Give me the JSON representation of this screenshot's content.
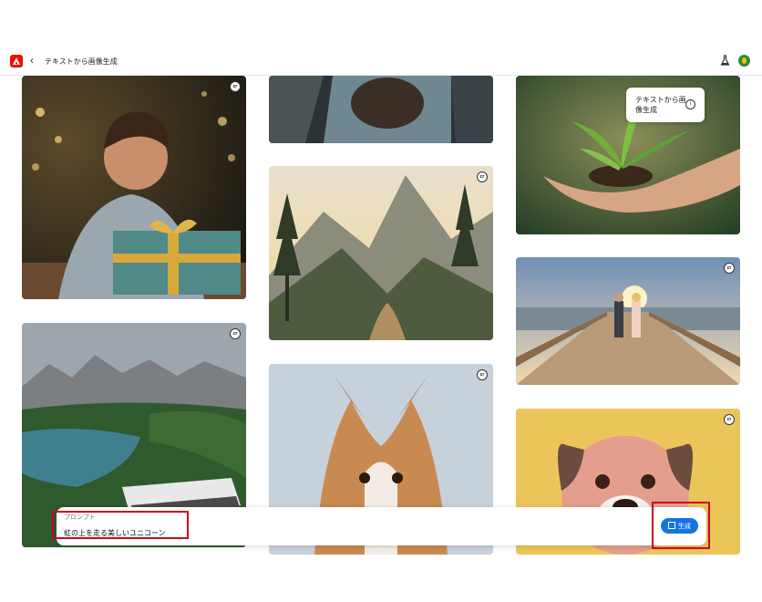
{
  "header": {
    "back_label": "‹",
    "title": "テキストから画像生成"
  },
  "gallery": {
    "credential_badge": "cr",
    "tooltip_text": "テキストから画像生成",
    "info_icon": "i"
  },
  "prompt": {
    "label": "プロンプト",
    "value": "虹の上を走る美しいユニコーン",
    "generate_label": "生成"
  },
  "colors": {
    "brand": "#eb1000",
    "accent": "#1473e6",
    "highlight": "#d0021b"
  },
  "icons": [
    "adobe-logo-icon",
    "chevron-left-icon",
    "flask-icon",
    "avatar",
    "content-credentials-icon",
    "info-icon",
    "generate-icon"
  ]
}
